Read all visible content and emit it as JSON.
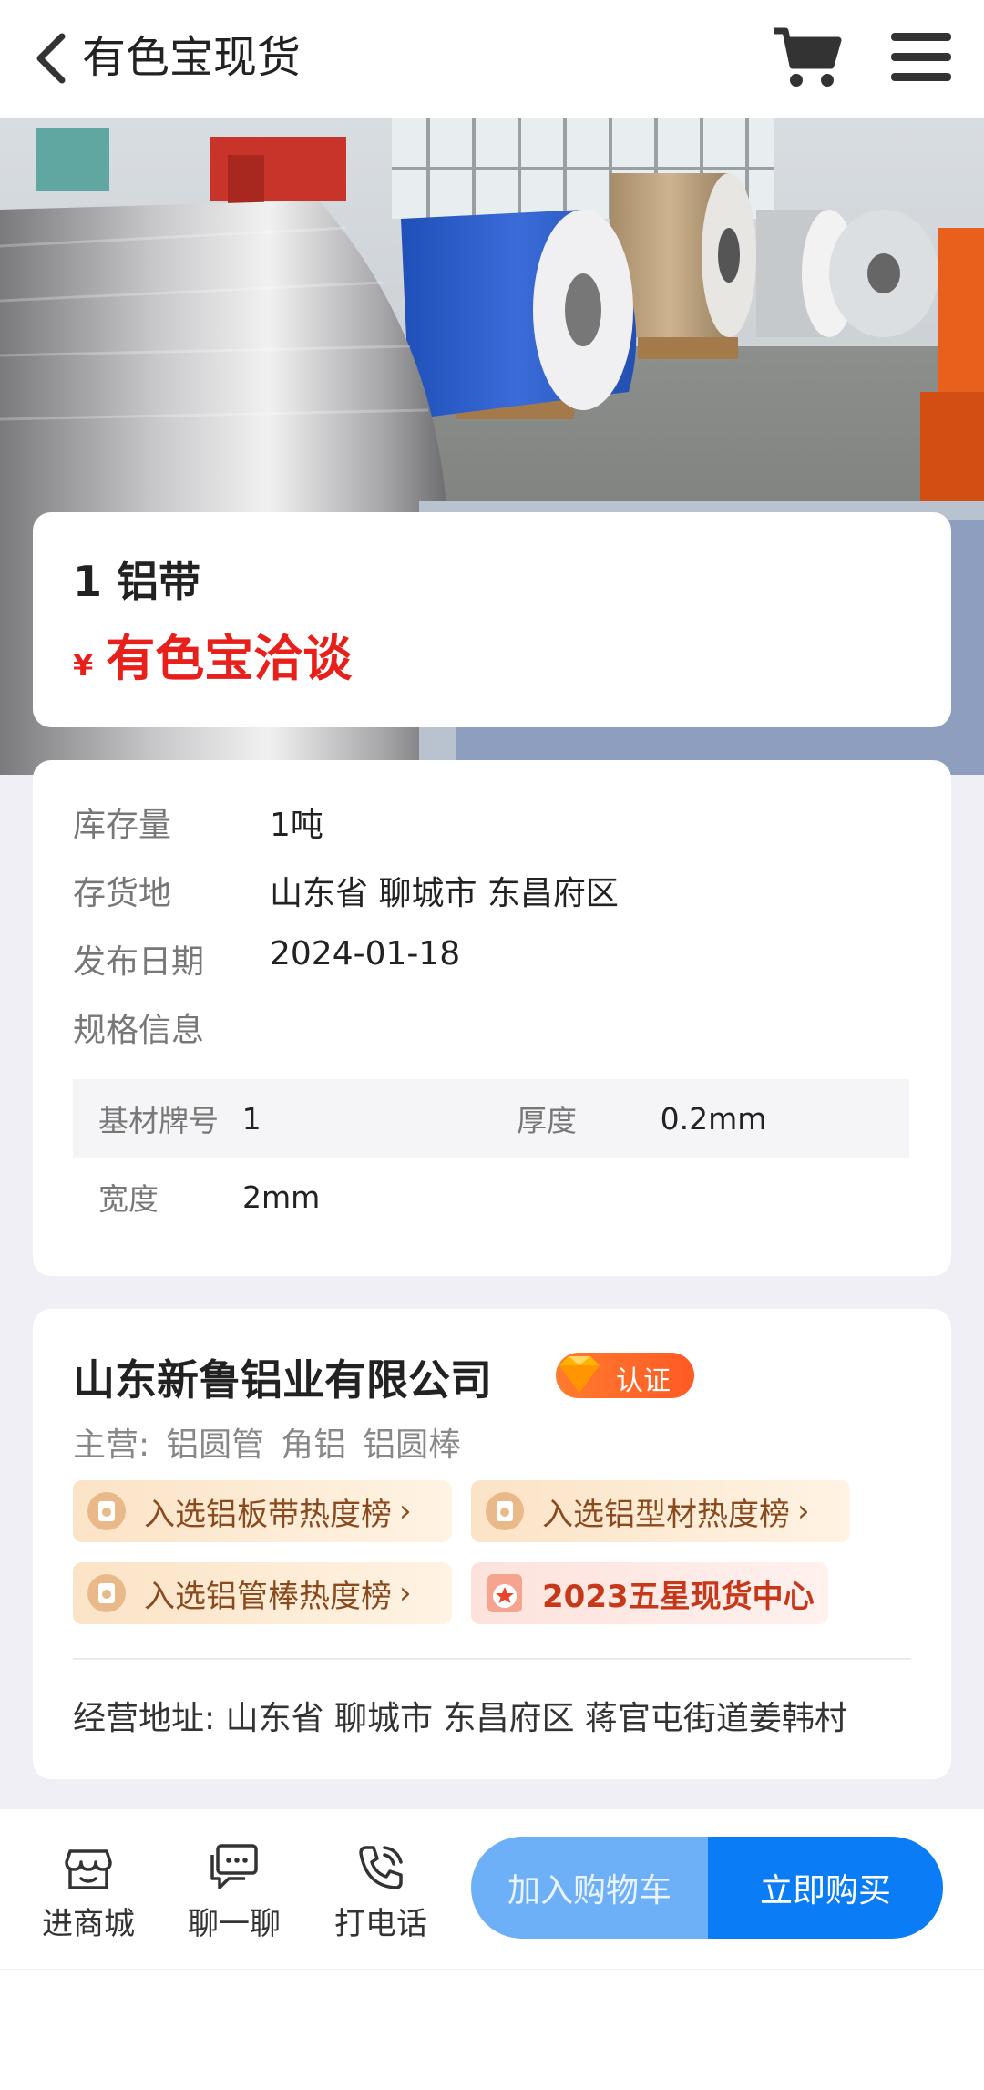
{
  "header": {
    "title": "有色宝现货",
    "back_icon": "chevron-left-icon",
    "cart_icon": "shopping-cart-icon",
    "menu_icon": "hamburger-menu-icon"
  },
  "hero": {
    "description_icon": "product-photo"
  },
  "product": {
    "name": "1 铝带",
    "price_symbol": "¥",
    "price_text": "有色宝洽谈"
  },
  "info": {
    "rows": [
      {
        "label": "库存量",
        "value": "1吨"
      },
      {
        "label": "存货地",
        "value": "山东省 聊城市 东昌府区"
      },
      {
        "label": "发布日期",
        "value": "2024-01-18"
      },
      {
        "label": "规格信息",
        "value": ""
      }
    ],
    "specs": [
      {
        "label1": "基材牌号",
        "value1": "1",
        "label2": "厚度",
        "value2": "0.2mm"
      },
      {
        "label1": "宽度",
        "value1": "2mm",
        "label2": "",
        "value2": ""
      }
    ]
  },
  "company": {
    "name": "山东新鲁铝业有限公司",
    "cert_label": "认证",
    "main_prefix": "主营:",
    "main_items": [
      "铝圆管",
      "角铝",
      "铝圆棒"
    ],
    "tags": [
      {
        "label": "入选铝板带热度榜",
        "chevron": "›"
      },
      {
        "label": "入选铝型材热度榜",
        "chevron": "›"
      },
      {
        "label": "入选铝管棒热度榜",
        "chevron": "›"
      },
      {
        "label": "2023五星现货中心",
        "chevron": ""
      }
    ],
    "address_label": "经营地址:",
    "address": "山东省 聊城市 东昌府区 蒋官屯街道姜韩村"
  },
  "bottom_bar": {
    "store_label": "进商城",
    "chat_label": "聊一聊",
    "call_label": "打电话",
    "add_cart_label": "加入购物车",
    "buy_now_label": "立即购买"
  },
  "colors": {
    "price_red": "#e8201c",
    "primary_blue": "#0a7cf5",
    "light_blue": "#6eb0f7",
    "cert_orange": "#ff6a28"
  }
}
